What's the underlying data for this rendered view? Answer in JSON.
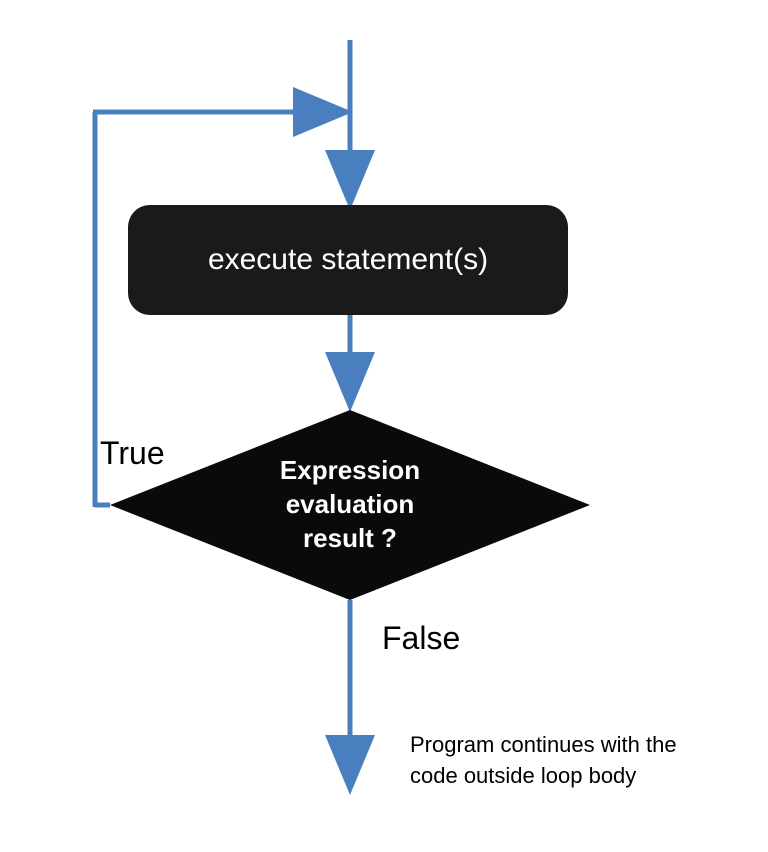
{
  "flowchart": {
    "process_box": "execute statement(s)",
    "decision_line1": "Expression",
    "decision_line2": "evaluation",
    "decision_line3": "result ?",
    "true_label": "True",
    "false_label": "False",
    "end_line1": "Program continues with the",
    "end_line2": "code outside loop body"
  },
  "colors": {
    "arrow": "#4A7FBF",
    "box": "#1a1a1a"
  }
}
